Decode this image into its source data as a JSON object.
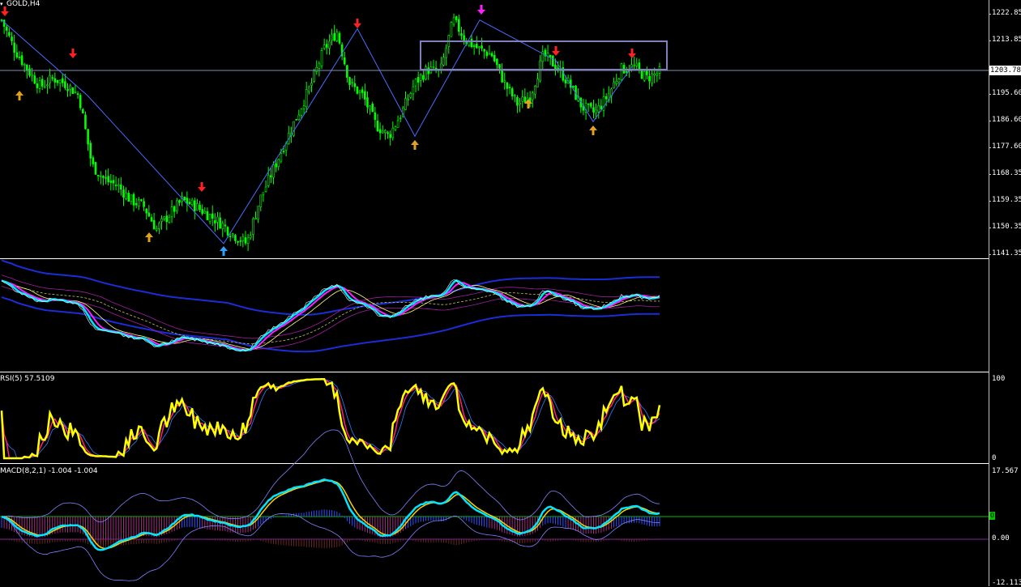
{
  "chart_header": {
    "title": "GOLD,H4"
  },
  "main_axis": {
    "labels": [
      "1222.85",
      "1213.85",
      "1195.60",
      "1186.60",
      "1177.60",
      "1168.35",
      "1159.35",
      "1150.35",
      "1141.35"
    ],
    "current_price": "1203.78"
  },
  "rsi_pane": {
    "title": "RSI(5) 57.5109",
    "axis_top": "100",
    "axis_bottom": "0"
  },
  "macd_pane": {
    "title": "MACD(8,2,1) -1.004 -1.004",
    "axis_top": "17.567",
    "axis_zero_marker": "0",
    "axis_zero": "0.00",
    "axis_bottom": "-12.113"
  },
  "colors": {
    "bull": "#00ff00",
    "bear": "#00ff00",
    "zigzag": "#4a6cff",
    "arrow_up": "#e0a020",
    "arrow_down": "#ff2020",
    "arrow_peak": "#ff20ff",
    "arrow_low": "#30a0ff",
    "box": "#8080c0",
    "rsi_main": "#ffff00",
    "rsi_signal": "#ff2080",
    "macd_main": "#00e5ff"
  },
  "chart_data": {
    "type": "line",
    "title": "GOLD,H4",
    "ylim": [
      1141.35,
      1225.0
    ],
    "series": [
      {
        "values": [
          1222,
          1212,
          1205,
          1199,
          1202,
          1200,
          1196,
          1172,
          1167,
          1165,
          1160,
          1158,
          1150,
          1155,
          1160,
          1158,
          1155,
          1152,
          1148,
          1145,
          1160,
          1170,
          1180,
          1190,
          1200,
          1212,
          1218,
          1200,
          1196,
          1186,
          1182,
          1190,
          1200,
          1205,
          1204,
          1222,
          1215,
          1212,
          1210,
          1200,
          1193,
          1196,
          1210,
          1206,
          1200,
          1192,
          1190,
          1196,
          1205,
          1206,
          1202,
          1204
        ]
      }
    ]
  }
}
